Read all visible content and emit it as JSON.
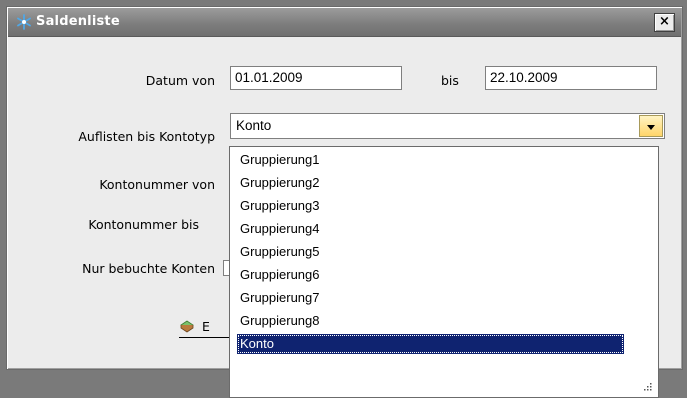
{
  "window": {
    "title": "Saldenliste",
    "close_glyph": "×",
    "icon": "asterisk-star-icon"
  },
  "form": {
    "datum_von_label": "Datum von",
    "datum_von_value": "01.01.2009",
    "bis_label": "bis",
    "bis_value": "22.10.2009",
    "auflisten_label": "Auflisten bis Kontotyp",
    "auflisten_value": "Konto",
    "kontonummer_von_label": "Kontonummer von",
    "kontonummer_bis_label": "Kontonummer bis",
    "nur_bebuchte_label": "Nur bebuchte Konten",
    "export_button_label": "E"
  },
  "dropdown": {
    "items": [
      "Gruppierung1",
      "Gruppierung2",
      "Gruppierung3",
      "Gruppierung4",
      "Gruppierung5",
      "Gruppierung6",
      "Gruppierung7",
      "Gruppierung8",
      "Konto"
    ],
    "selected": "Konto"
  },
  "colors": {
    "selection": "#0f2370",
    "titlebar": "#7e7e7e",
    "dialog_bg": "#ececec",
    "combo_button": "#ffd56a"
  }
}
